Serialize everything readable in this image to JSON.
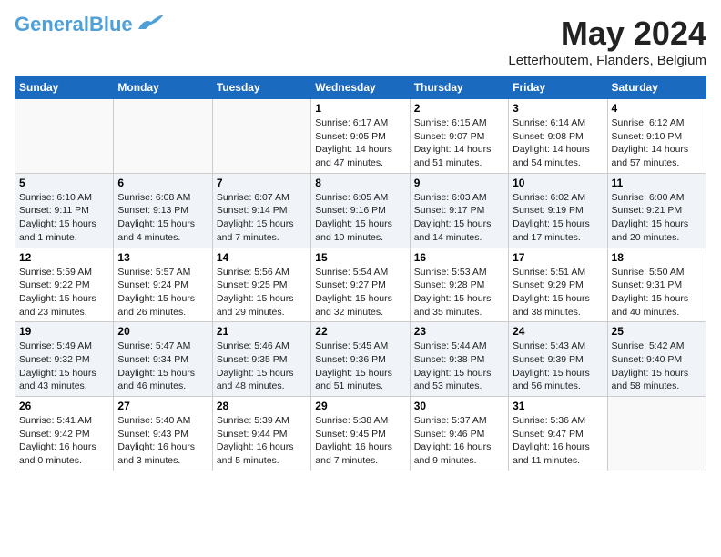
{
  "header": {
    "logo_general": "General",
    "logo_blue": "Blue",
    "month": "May 2024",
    "location": "Letterhoutem, Flanders, Belgium"
  },
  "weekdays": [
    "Sunday",
    "Monday",
    "Tuesday",
    "Wednesday",
    "Thursday",
    "Friday",
    "Saturday"
  ],
  "weeks": [
    [
      {
        "day": "",
        "info": ""
      },
      {
        "day": "",
        "info": ""
      },
      {
        "day": "",
        "info": ""
      },
      {
        "day": "1",
        "info": "Sunrise: 6:17 AM\nSunset: 9:05 PM\nDaylight: 14 hours and 47 minutes."
      },
      {
        "day": "2",
        "info": "Sunrise: 6:15 AM\nSunset: 9:07 PM\nDaylight: 14 hours and 51 minutes."
      },
      {
        "day": "3",
        "info": "Sunrise: 6:14 AM\nSunset: 9:08 PM\nDaylight: 14 hours and 54 minutes."
      },
      {
        "day": "4",
        "info": "Sunrise: 6:12 AM\nSunset: 9:10 PM\nDaylight: 14 hours and 57 minutes."
      }
    ],
    [
      {
        "day": "5",
        "info": "Sunrise: 6:10 AM\nSunset: 9:11 PM\nDaylight: 15 hours and 1 minute."
      },
      {
        "day": "6",
        "info": "Sunrise: 6:08 AM\nSunset: 9:13 PM\nDaylight: 15 hours and 4 minutes."
      },
      {
        "day": "7",
        "info": "Sunrise: 6:07 AM\nSunset: 9:14 PM\nDaylight: 15 hours and 7 minutes."
      },
      {
        "day": "8",
        "info": "Sunrise: 6:05 AM\nSunset: 9:16 PM\nDaylight: 15 hours and 10 minutes."
      },
      {
        "day": "9",
        "info": "Sunrise: 6:03 AM\nSunset: 9:17 PM\nDaylight: 15 hours and 14 minutes."
      },
      {
        "day": "10",
        "info": "Sunrise: 6:02 AM\nSunset: 9:19 PM\nDaylight: 15 hours and 17 minutes."
      },
      {
        "day": "11",
        "info": "Sunrise: 6:00 AM\nSunset: 9:21 PM\nDaylight: 15 hours and 20 minutes."
      }
    ],
    [
      {
        "day": "12",
        "info": "Sunrise: 5:59 AM\nSunset: 9:22 PM\nDaylight: 15 hours and 23 minutes."
      },
      {
        "day": "13",
        "info": "Sunrise: 5:57 AM\nSunset: 9:24 PM\nDaylight: 15 hours and 26 minutes."
      },
      {
        "day": "14",
        "info": "Sunrise: 5:56 AM\nSunset: 9:25 PM\nDaylight: 15 hours and 29 minutes."
      },
      {
        "day": "15",
        "info": "Sunrise: 5:54 AM\nSunset: 9:27 PM\nDaylight: 15 hours and 32 minutes."
      },
      {
        "day": "16",
        "info": "Sunrise: 5:53 AM\nSunset: 9:28 PM\nDaylight: 15 hours and 35 minutes."
      },
      {
        "day": "17",
        "info": "Sunrise: 5:51 AM\nSunset: 9:29 PM\nDaylight: 15 hours and 38 minutes."
      },
      {
        "day": "18",
        "info": "Sunrise: 5:50 AM\nSunset: 9:31 PM\nDaylight: 15 hours and 40 minutes."
      }
    ],
    [
      {
        "day": "19",
        "info": "Sunrise: 5:49 AM\nSunset: 9:32 PM\nDaylight: 15 hours and 43 minutes."
      },
      {
        "day": "20",
        "info": "Sunrise: 5:47 AM\nSunset: 9:34 PM\nDaylight: 15 hours and 46 minutes."
      },
      {
        "day": "21",
        "info": "Sunrise: 5:46 AM\nSunset: 9:35 PM\nDaylight: 15 hours and 48 minutes."
      },
      {
        "day": "22",
        "info": "Sunrise: 5:45 AM\nSunset: 9:36 PM\nDaylight: 15 hours and 51 minutes."
      },
      {
        "day": "23",
        "info": "Sunrise: 5:44 AM\nSunset: 9:38 PM\nDaylight: 15 hours and 53 minutes."
      },
      {
        "day": "24",
        "info": "Sunrise: 5:43 AM\nSunset: 9:39 PM\nDaylight: 15 hours and 56 minutes."
      },
      {
        "day": "25",
        "info": "Sunrise: 5:42 AM\nSunset: 9:40 PM\nDaylight: 15 hours and 58 minutes."
      }
    ],
    [
      {
        "day": "26",
        "info": "Sunrise: 5:41 AM\nSunset: 9:42 PM\nDaylight: 16 hours and 0 minutes."
      },
      {
        "day": "27",
        "info": "Sunrise: 5:40 AM\nSunset: 9:43 PM\nDaylight: 16 hours and 3 minutes."
      },
      {
        "day": "28",
        "info": "Sunrise: 5:39 AM\nSunset: 9:44 PM\nDaylight: 16 hours and 5 minutes."
      },
      {
        "day": "29",
        "info": "Sunrise: 5:38 AM\nSunset: 9:45 PM\nDaylight: 16 hours and 7 minutes."
      },
      {
        "day": "30",
        "info": "Sunrise: 5:37 AM\nSunset: 9:46 PM\nDaylight: 16 hours and 9 minutes."
      },
      {
        "day": "31",
        "info": "Sunrise: 5:36 AM\nSunset: 9:47 PM\nDaylight: 16 hours and 11 minutes."
      },
      {
        "day": "",
        "info": ""
      }
    ]
  ]
}
